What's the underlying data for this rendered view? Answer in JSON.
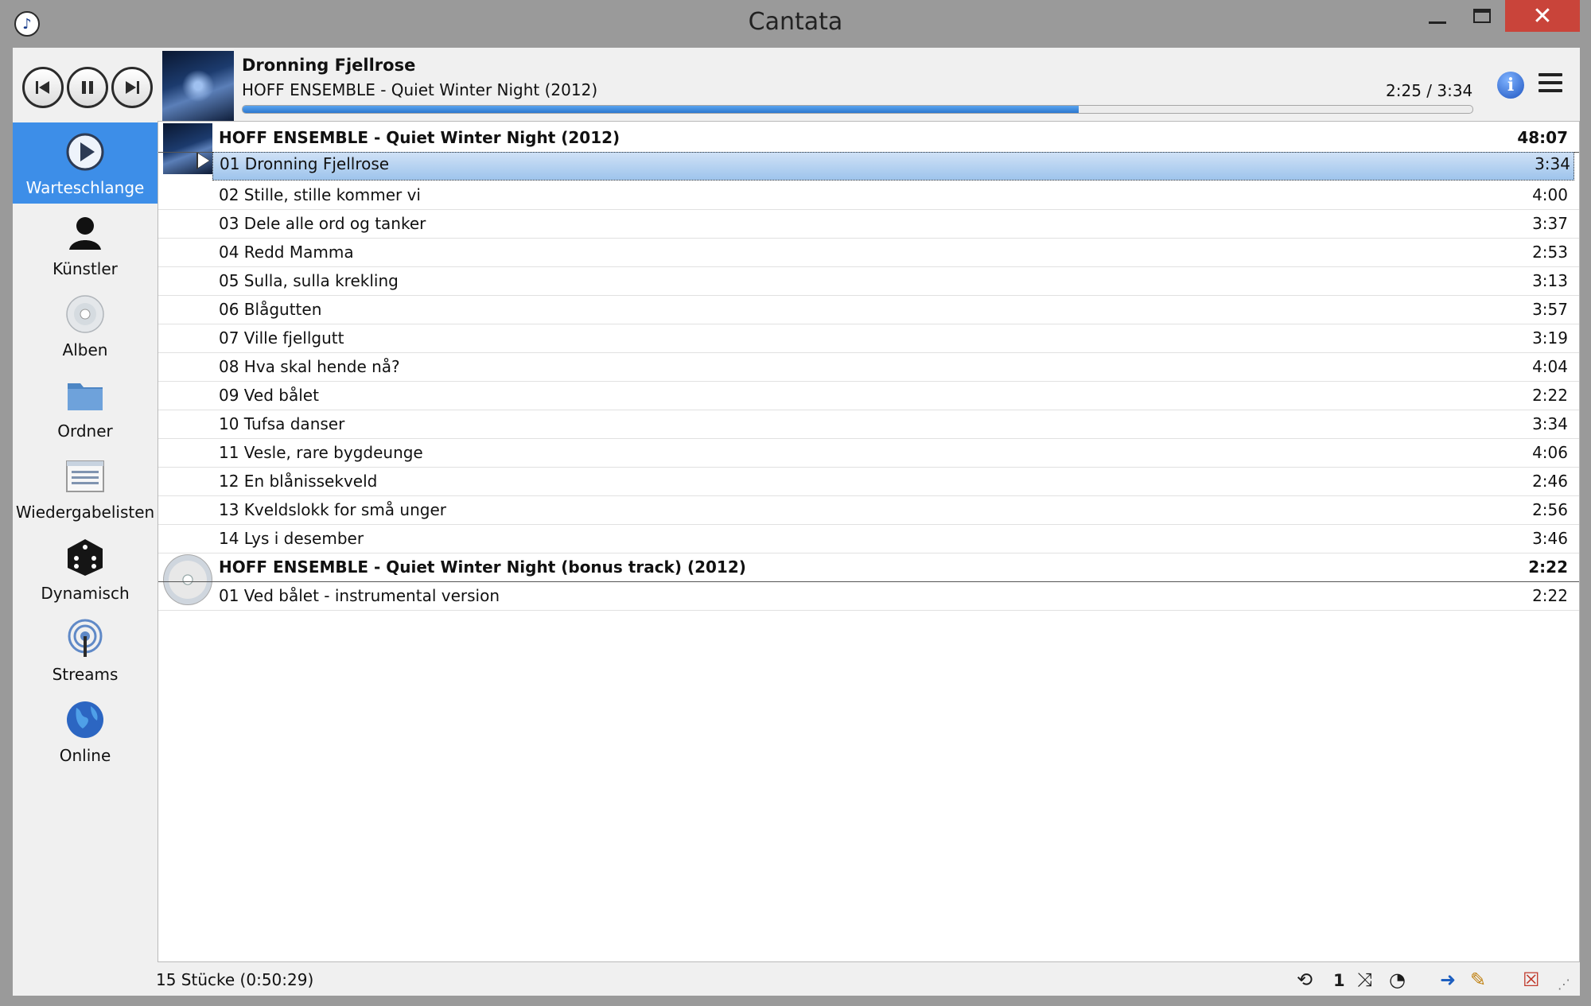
{
  "window": {
    "title": "Cantata",
    "controls": {
      "minimize": "minimize",
      "maximize": "maximize",
      "close": "✕"
    }
  },
  "toolbar": {
    "now_playing": {
      "title": "Dronning Fjellrose",
      "subtitle": "HOFF ENSEMBLE - Quiet Winter Night (2012)",
      "time": "2:25 / 3:34",
      "progress_fraction": 0.68
    },
    "buttons": [
      "previous-track",
      "pause",
      "next-track",
      "info",
      "menu"
    ]
  },
  "sidebar": {
    "items": [
      {
        "label": "Warteschlange",
        "icon": "play-queue-icon",
        "active": true
      },
      {
        "label": "Künstler",
        "icon": "artist-icon",
        "active": false
      },
      {
        "label": "Alben",
        "icon": "cd-icon",
        "active": false
      },
      {
        "label": "Ordner",
        "icon": "folder-icon",
        "active": false
      },
      {
        "label": "Wiedergabelisten",
        "icon": "playlist-icon",
        "active": false
      },
      {
        "label": "Dynamisch",
        "icon": "dice-icon",
        "active": false
      },
      {
        "label": "Streams",
        "icon": "stream-icon",
        "active": false
      },
      {
        "label": "Online",
        "icon": "globe-icon",
        "active": false
      }
    ]
  },
  "playlist": {
    "groups": [
      {
        "header": "HOFF ENSEMBLE - Quiet Winter Night (2012)",
        "total": "48:07",
        "tracks": [
          {
            "title": "01 Dronning Fjellrose",
            "duration": "3:34",
            "playing": true
          },
          {
            "title": "02 Stille, stille kommer vi",
            "duration": "4:00"
          },
          {
            "title": "03 Dele alle ord og tanker",
            "duration": "3:37"
          },
          {
            "title": "04 Redd Mamma",
            "duration": "2:53"
          },
          {
            "title": "05 Sulla, sulla krekling",
            "duration": "3:13"
          },
          {
            "title": "06 Blågutten",
            "duration": "3:57"
          },
          {
            "title": "07 Ville fjellgutt",
            "duration": "3:19"
          },
          {
            "title": "08 Hva skal hende nå?",
            "duration": "4:04"
          },
          {
            "title": "09 Ved bålet",
            "duration": "2:22"
          },
          {
            "title": "10 Tufsa danser",
            "duration": "3:34"
          },
          {
            "title": "11 Vesle, rare bygdeunge",
            "duration": "4:06"
          },
          {
            "title": "12 En blånissekveld",
            "duration": "2:46"
          },
          {
            "title": "13 Kveldslokk for små unger",
            "duration": "2:56"
          },
          {
            "title": "14 Lys i desember",
            "duration": "3:46"
          }
        ]
      },
      {
        "header": "HOFF ENSEMBLE - Quiet Winter Night (bonus track) (2012)",
        "total": "2:22",
        "tracks": [
          {
            "title": "01 Ved bålet - instrumental version",
            "duration": "2:22"
          }
        ]
      }
    ]
  },
  "status": {
    "summary": "15 Stücke (0:50:29)",
    "single_indicator": "1",
    "icons": [
      "repeat-icon",
      "single-icon",
      "shuffle-icon",
      "consume-icon",
      "go-to-current-icon",
      "edit-playlist-icon",
      "clear-playlist-icon",
      "resize-grip-icon"
    ]
  }
}
